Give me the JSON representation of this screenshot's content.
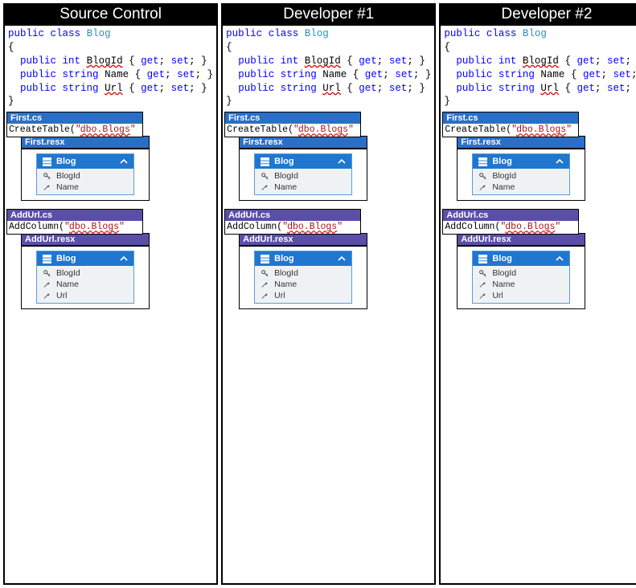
{
  "columns": [
    {
      "header": "Source Control"
    },
    {
      "header": "Developer #1"
    },
    {
      "header": "Developer #2"
    }
  ],
  "code": {
    "kw_public": "public",
    "kw_class": "class",
    "cls_name": "Blog",
    "brace_open": "{",
    "brace_close": "}",
    "kw_int": "int",
    "kw_string": "string",
    "prop_BlogId": "BlogId",
    "prop_Name": "Name",
    "prop_Url": "Url",
    "accessors": " { ",
    "get": "get",
    "set": "set",
    "semi": "; }"
  },
  "firstCs": {
    "title": "First.cs",
    "call": "CreateTable(",
    "quote": "\"",
    "dbo": "dbo.Blogs",
    "quote2": "\""
  },
  "firstResx": {
    "title": "First.resx",
    "entity": "Blog",
    "props": [
      "BlogId",
      "Name"
    ]
  },
  "addUrlCs": {
    "title": "AddUrl.cs",
    "call": "AddColumn(",
    "quote": "\"",
    "dbo": "dbo.Blogs",
    "quote2": "\""
  },
  "addUrlResx": {
    "title": "AddUrl.resx",
    "entity": "Blog",
    "props": [
      "BlogId",
      "Name",
      "Url"
    ]
  }
}
